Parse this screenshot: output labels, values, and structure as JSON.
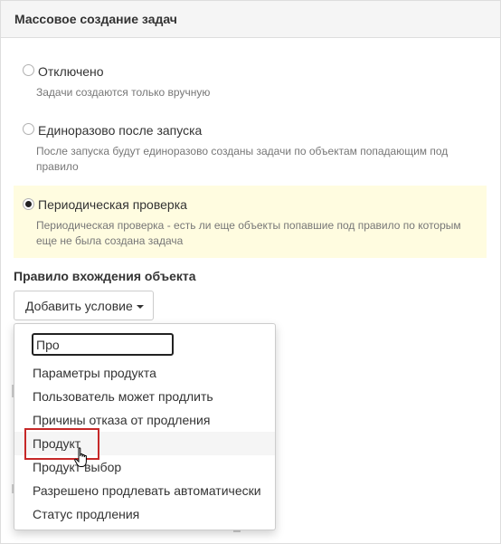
{
  "panel": {
    "title": "Массовое создание задач"
  },
  "options": [
    {
      "label": "Отключено",
      "description": "Задачи создаются только вручную",
      "checked": false
    },
    {
      "label": "Единоразово после запуска",
      "description": "После запуска будут единоразово созданы задачи по объектам попадающим под правило",
      "checked": false
    },
    {
      "label": "Периодическая проверка",
      "description": "Периодическая проверка - есть ли еще объекты попавшие под правило по которым еще не была создана задача",
      "checked": true
    }
  ],
  "rule": {
    "title": "Правило вхождения объекта",
    "add_button": "Добавить условие"
  },
  "dropdown": {
    "search_value": "Про",
    "items": [
      "Параметры продукта",
      "Пользователь может продлить",
      "Причины отказа от продления",
      "Продукт",
      "Продукт выбор",
      "Разрешено продлевать автоматически",
      "Статус продления"
    ],
    "hovered_item": "Продукт"
  },
  "colors": {
    "selected_option_bg": "#fffce0",
    "highlight_border": "#c62828",
    "header_bg": "#f5f5f5"
  },
  "icons": [
    "caret-down-icon",
    "hand-pointer-icon"
  ]
}
